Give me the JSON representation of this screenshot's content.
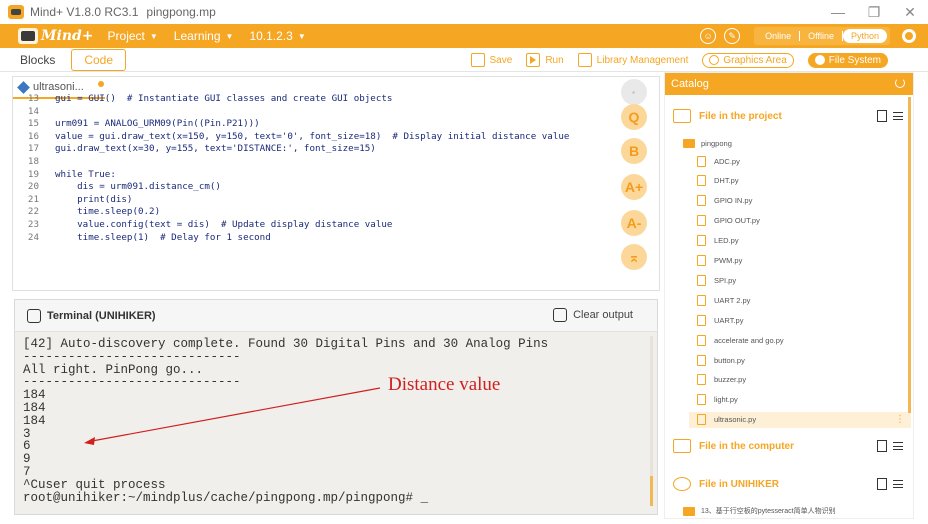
{
  "window": {
    "title": "Mind+ V1.8.0 RC3.1",
    "file": "pingpong.mp",
    "controls": [
      "—",
      "❐",
      "✕"
    ]
  },
  "menubar": {
    "logo": "Mind+",
    "items": [
      {
        "label": "Project"
      },
      {
        "label": "Learning"
      },
      {
        "label": "10.1.2.3"
      }
    ],
    "modes": [
      "Online",
      "Offline",
      "Python"
    ],
    "active_mode": "Python"
  },
  "toolbar": {
    "blocks": "Blocks",
    "code": "Code",
    "save": "Save",
    "run": "Run",
    "library": "Library Management",
    "graphics": "Graphics Area",
    "filesystem": "File System"
  },
  "editor": {
    "tab": "ultrasoni...",
    "lines": [
      {
        "n": "13",
        "code": "gui = GUI()  # Instantiate GUI classes and create GUI objects"
      },
      {
        "n": "14",
        "code": ""
      },
      {
        "n": "15",
        "code": "urm091 = ANALOG_URM09(Pin((Pin.P21)))"
      },
      {
        "n": "16",
        "code": "value = gui.draw_text(x=150, y=150, text='0', font_size=18)  # Display initial distance value"
      },
      {
        "n": "17",
        "code": "gui.draw_text(x=30, y=155, text='DISTANCE:', font_size=15)"
      },
      {
        "n": "18",
        "code": ""
      },
      {
        "n": "19",
        "code": "while True:"
      },
      {
        "n": "20",
        "code": "    dis = urm091.distance_cm()"
      },
      {
        "n": "21",
        "code": "    print(dis)"
      },
      {
        "n": "22",
        "code": "    time.sleep(0.2)"
      },
      {
        "n": "23",
        "code": "    value.config(text = dis)  # Update display distance value"
      },
      {
        "n": "24",
        "code": "    time.sleep(1)  # Delay for 1 second"
      }
    ],
    "side_icons": [
      "Q",
      "B",
      "A+",
      "A-",
      "⌅"
    ]
  },
  "terminal": {
    "title": "Terminal (UNIHIKER)",
    "clear": "Clear output",
    "output": "[42] Auto-discovery complete. Found 30 Digital Pins and 30 Analog Pins\n-----------------------------\nAll right. PinPong go...\n-----------------------------\n184\n184\n184\n3\n6\n9\n7\n^Cuser quit process\nroot@unihiker:~/mindplus/cache/pingpong.mp/pingpong# _"
  },
  "annotation": {
    "label": "Distance value",
    "color": "#d01f1f"
  },
  "catalog": {
    "title": "Catalog",
    "project_section": "File in the project",
    "folder": "pingpong",
    "files": [
      "ADC.py",
      "DHT.py",
      "GPIO IN.py",
      "GPIO OUT.py",
      "LED.py",
      "PWM.py",
      "SPI.py",
      "UART 2.py",
      "UART.py",
      "accelerate and go.py",
      "button.py",
      "buzzer.py",
      "light.py",
      "ultrasonic.py"
    ],
    "selected_file": "ultrasonic.py",
    "computer_section": "File in the computer",
    "unihiker_section": "File in UNIHIKER",
    "unihiker_item": "13、基于行空板的pytesseract简单人物识别"
  },
  "colors": {
    "accent": "#f5a623",
    "annotation": "#d01f1f"
  }
}
